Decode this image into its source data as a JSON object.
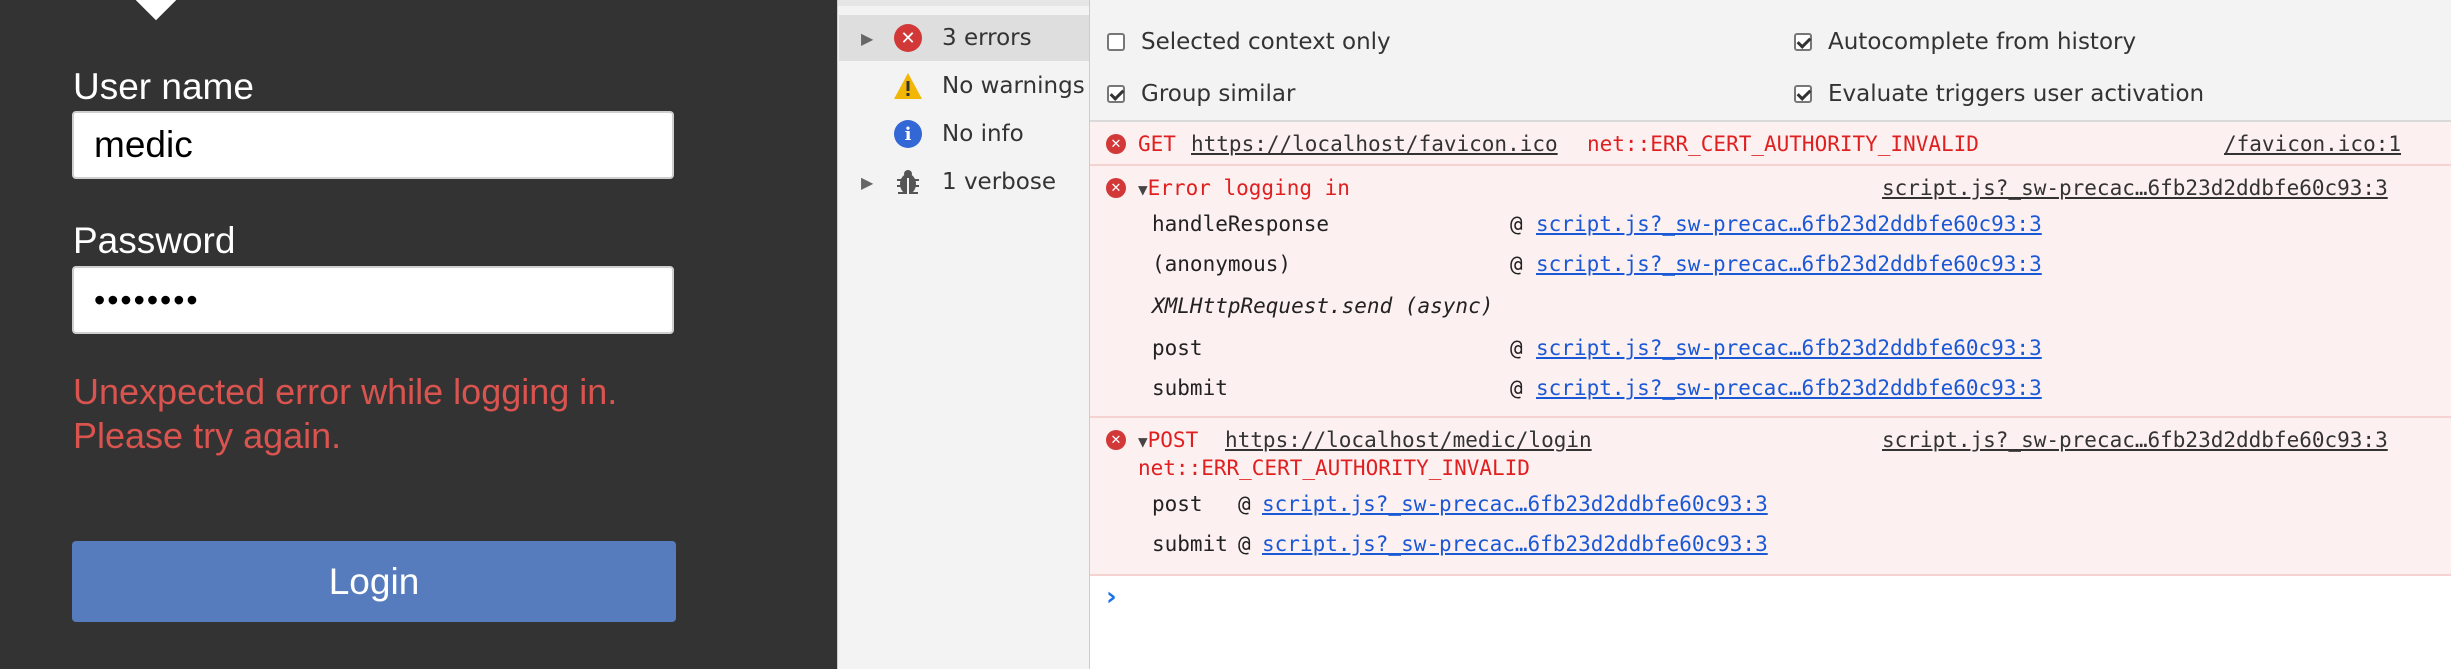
{
  "login": {
    "username_label": "User name",
    "username_value": "medic",
    "password_label": "Password",
    "password_value": "••••••••",
    "error_line1": "Unexpected error while logging in.",
    "error_line2": "Please try again.",
    "button_label": "Login",
    "colors": {
      "panel_bg": "#333333",
      "error": "#d9534f",
      "button_bg": "#567cbe"
    }
  },
  "sidebar": {
    "items": [
      {
        "label": "3 errors",
        "icon": "error-icon",
        "selected": true
      },
      {
        "label": "No warnings",
        "icon": "warning-icon",
        "selected": false
      },
      {
        "label": "No info",
        "icon": "info-icon",
        "selected": false
      },
      {
        "label": "1 verbose",
        "icon": "bug-icon",
        "selected": false
      }
    ]
  },
  "settings": {
    "selected_context_only": {
      "label": "Selected context only",
      "checked": false
    },
    "group_similar": {
      "label": "Group similar",
      "checked": true
    },
    "autocomplete_from_history": {
      "label": "Autocomplete from history",
      "checked": true
    },
    "evaluate_triggers_user_activation": {
      "label": "Evaluate triggers user activation",
      "checked": true
    }
  },
  "console": {
    "msg1": {
      "method": "GET",
      "url": "https://localhost/favicon.ico",
      "error": "net::ERR_CERT_AUTHORITY_INVALID",
      "source": "/favicon.ico:1"
    },
    "msg2": {
      "title": "Error logging in",
      "source": "script.js?_sw-precac…6fb23d2ddbfe60c93:3",
      "stack": [
        {
          "fn": "handleResponse",
          "at": "@",
          "link": "script.js?_sw-precac…6fb23d2ddbfe60c93:3"
        },
        {
          "fn": "(anonymous)",
          "at": "@",
          "link": "script.js?_sw-precac…6fb23d2ddbfe60c93:3"
        },
        {
          "fn": "XMLHttpRequest.send (async)"
        },
        {
          "fn": "post",
          "at": "@",
          "link": "script.js?_sw-precac…6fb23d2ddbfe60c93:3"
        },
        {
          "fn": "submit",
          "at": "@",
          "link": "script.js?_sw-precac…6fb23d2ddbfe60c93:3"
        }
      ]
    },
    "msg3": {
      "method": "POST",
      "url": "https://localhost/medic/login",
      "error": "net::ERR_CERT_AUTHORITY_INVALID",
      "source": "script.js?_sw-precac…6fb23d2ddbfe60c93:3",
      "stack": [
        {
          "fn": "post",
          "at": "@",
          "link": "script.js?_sw-precac…6fb23d2ddbfe60c93:3"
        },
        {
          "fn": "submit",
          "at": "@",
          "link": "script.js?_sw-precac…6fb23d2ddbfe60c93:3"
        }
      ]
    },
    "prompt_symbol": "›"
  }
}
